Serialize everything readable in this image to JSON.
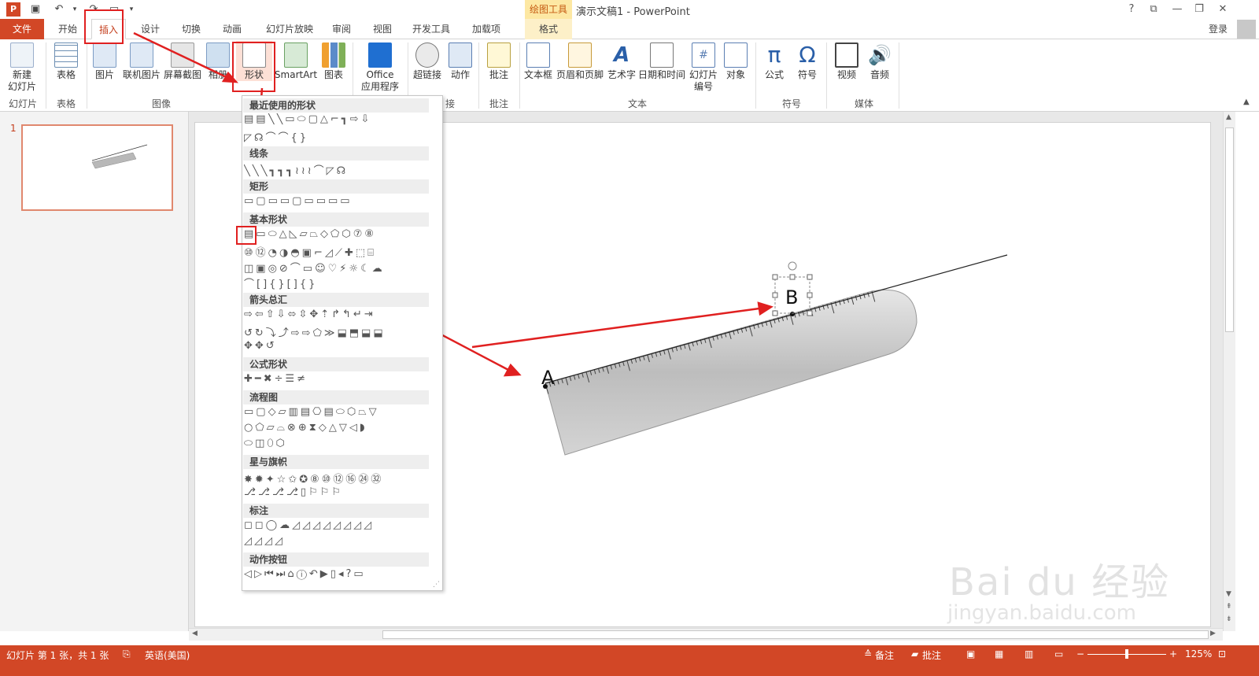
{
  "title_bar": {
    "app_title": "演示文稿1 - PowerPoint",
    "context_tool": "绘图工具",
    "help": "?",
    "win_restore_ribbon": "⧉",
    "win_min": "—",
    "win_max": "❐",
    "win_close": "✕"
  },
  "tabs": [
    {
      "label": "文件"
    },
    {
      "label": "开始"
    },
    {
      "label": "插入"
    },
    {
      "label": "设计"
    },
    {
      "label": "切换"
    },
    {
      "label": "动画"
    },
    {
      "label": "幻灯片放映"
    },
    {
      "label": "审阅"
    },
    {
      "label": "视图"
    },
    {
      "label": "开发工具"
    },
    {
      "label": "加载项"
    },
    {
      "label": "格式"
    }
  ],
  "account": {
    "login_label": "登录"
  },
  "ribbon": {
    "buttons": [
      {
        "label": "新建\n幻灯片",
        "icon": "new-slide-icon"
      },
      {
        "label": "表格",
        "icon": "table-icon"
      },
      {
        "label": "图片",
        "icon": "picture-icon"
      },
      {
        "label": "联机图片",
        "icon": "online-picture-icon"
      },
      {
        "label": "屏幕截图",
        "icon": "screenshot-icon"
      },
      {
        "label": "相册",
        "icon": "album-icon"
      },
      {
        "label": "形状",
        "icon": "shapes-icon"
      },
      {
        "label": "SmartArt",
        "icon": "smartart-icon"
      },
      {
        "label": "图表",
        "icon": "chart-icon"
      },
      {
        "label": "Office\n应用程序",
        "icon": "office-apps-icon"
      },
      {
        "label": "超链接",
        "icon": "hyperlink-icon"
      },
      {
        "label": "动作",
        "icon": "action-icon"
      },
      {
        "label": "批注",
        "icon": "comment-icon"
      },
      {
        "label": "文本框",
        "icon": "textbox-icon"
      },
      {
        "label": "页眉和页脚",
        "icon": "header-footer-icon"
      },
      {
        "label": "艺术字",
        "icon": "wordart-icon"
      },
      {
        "label": "日期和时间",
        "icon": "datetime-icon"
      },
      {
        "label": "幻灯片\n编号",
        "icon": "slide-number-icon"
      },
      {
        "label": "对象",
        "icon": "object-icon"
      },
      {
        "label": "公式",
        "icon": "equation-icon"
      },
      {
        "label": "符号",
        "icon": "symbol-icon"
      },
      {
        "label": "视频",
        "icon": "video-icon"
      },
      {
        "label": "音频",
        "icon": "audio-icon"
      }
    ],
    "groups": [
      {
        "label": "幻灯片"
      },
      {
        "label": "表格"
      },
      {
        "label": "图像"
      },
      {
        "label": "接"
      },
      {
        "label": "批注"
      },
      {
        "label": "文本"
      },
      {
        "label": "符号"
      },
      {
        "label": "媒体"
      }
    ]
  },
  "shapes_menu": {
    "sections": [
      {
        "label": "最近使用的形状"
      },
      {
        "label": "线条"
      },
      {
        "label": "矩形"
      },
      {
        "label": "基本形状"
      },
      {
        "label": "箭头总汇"
      },
      {
        "label": "公式形状"
      },
      {
        "label": "流程图"
      },
      {
        "label": "星与旗帜"
      },
      {
        "label": "标注"
      },
      {
        "label": "动作按钮"
      }
    ]
  },
  "slide_panel": {
    "slide_number": "1"
  },
  "slide": {
    "point_a": "A",
    "point_b": "B"
  },
  "status_bar": {
    "slide_info": "幻灯片 第 1 张，共 1 张",
    "language": "英语(美国)",
    "notes": "备注",
    "comments": "批注",
    "zoom": "125%"
  },
  "watermark": {
    "brand": "Bai du 经验",
    "url": "jingyan.baidu.com"
  },
  "colors": {
    "accent": "#d24726",
    "highlight": "#e02020"
  }
}
